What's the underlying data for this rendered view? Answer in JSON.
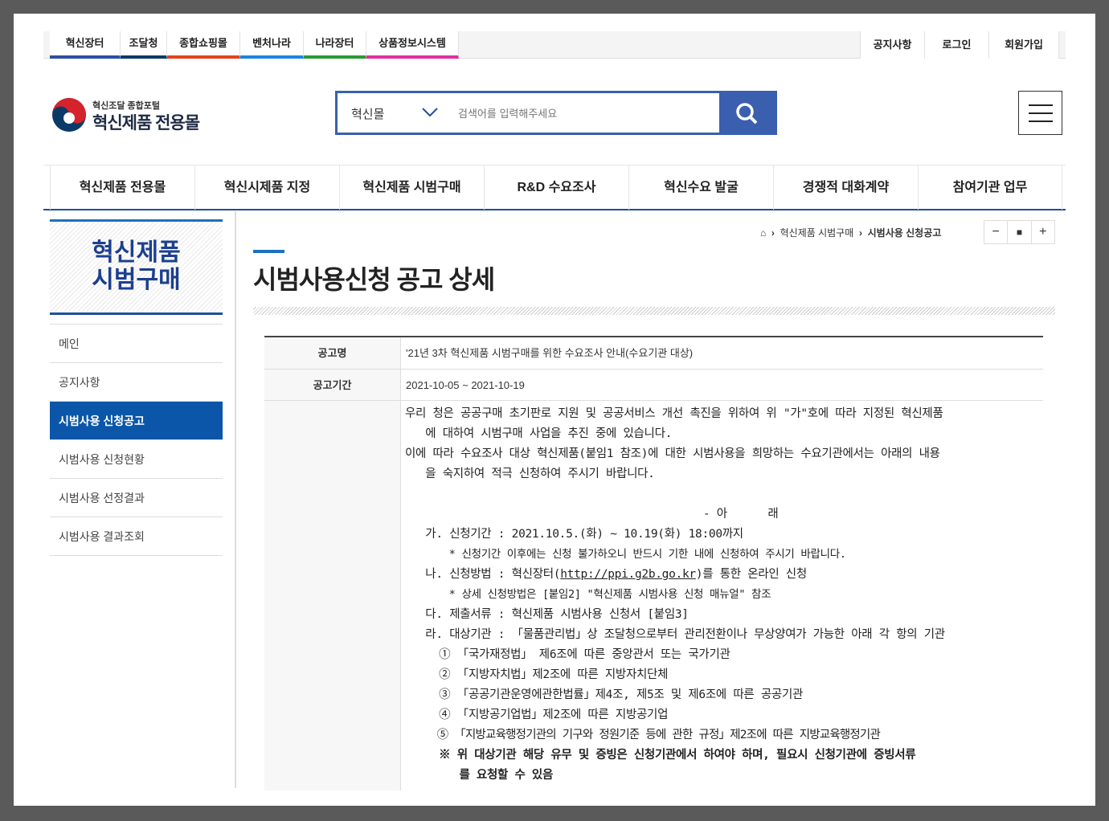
{
  "util_tabs": [
    {
      "label": "혁신장터",
      "color": "#2a4fa5"
    },
    {
      "label": "조달청",
      "color": "#0c3a67"
    },
    {
      "label": "종합쇼핑몰",
      "color": "#e2431e"
    },
    {
      "label": "벤처나라",
      "color": "#1a85e0"
    },
    {
      "label": "나라장터",
      "color": "#2a9a35"
    },
    {
      "label": "상품정보시스템",
      "color": "#df2fa0"
    }
  ],
  "util_right": [
    "공지사항",
    "로그인",
    "회원가입"
  ],
  "logo": {
    "sub": "혁신조달 종합포털",
    "main": "혁신제품 전용몰"
  },
  "search": {
    "category": "혁신몰",
    "placeholder": "검색어를 입력해주세요"
  },
  "gnb": [
    "혁신제품 전용몰",
    "혁신시제품 지정",
    "혁신제품 시범구매",
    "R&D 수요조사",
    "혁신수요 발굴",
    "경쟁적 대화계약",
    "참여기관 업무"
  ],
  "sidebar": {
    "title1": "혁신제품",
    "title2": "시범구매",
    "items": [
      "메인",
      "공지사항",
      "시범사용 신청공고",
      "시범사용 신청현황",
      "시범사용 선정결과",
      "시범사용 결과조회"
    ]
  },
  "breadcrumb": [
    "혁신제품 시범구매",
    "시범사용 신청공고"
  ],
  "font_controls": [
    "−",
    "■",
    "+"
  ],
  "page_title": "시범사용신청 공고 상세",
  "table": {
    "name_label": "공고명",
    "name": "'21년 3차 혁신제품 시범구매를 위한 수요조사 안내(수요기관 대상)",
    "period_label": "공고기간",
    "period": "2021-10-05 ~ 2021-10-19"
  },
  "body": [
    "우리 청은 공공구매 초기판로 지원 및 공공서비스 개선 촉진을 위하여 위 \"가\"호에 따라 지정된 혁신제품",
    "   에 대하여 시범구매 사업을 추진 중에 있습니다.",
    "이에 따라 수요조사 대상 혁신제품(붙임1 참조)에 대한 시범사용을 희망하는 수요기관에서는 아래의 내용",
    "   을 숙지하여 적극 신청하여 주시기 바랍니다.",
    "",
    "                                            - 아      래",
    "   가. 신청기간 : 2021.10.5.(화) ~ 10.19(화) 18:00까지",
    "       * 신청기간 이후에는 신청 불가하오니 반드시 기한 내에 신청하여 주시기 바랍니다.",
    "   나. 신청방법 : 혁신장터(",
    "       * 상세 신청방법은 [붙임2] \"혁신제품 시범사용 신청 매뉴얼\" 참조",
    "   다. 제출서류 : 혁신제품 시범사용 신청서 [붙임3]",
    "   라. 대상기관 : 「물품관리법」상 조달청으로부터 관리전환이나 무상양여가 가능한 아래 각 항의 기관",
    "     ① 「국가재정법」 제6조에 따른 중앙관서 또는 국가기관",
    "     ② 「지방자치법」제2조에 따른 지방자치단체",
    "     ③ 「공공기관운영에관한법률」제4조, 제5조 및 제6조에 따른 공공기관",
    "     ④ 「지방공기업법」제2조에 따른 지방공기업",
    "     ⑤ 「지방교육행정기관의 기구와 정원기준 등에 관한 규정」제2조에 따른 지방교육행정기관",
    "     ※ 위 대상기관 해당 유무 및 증빙은 신청기관에서 하여야 하며, 필요시 신청기관에 증빙서류",
    "        를 요청할 수 있음"
  ],
  "link": {
    "url": "http://ppi.g2b.go.kr",
    "after": ")를 통한 온라인 신청"
  }
}
